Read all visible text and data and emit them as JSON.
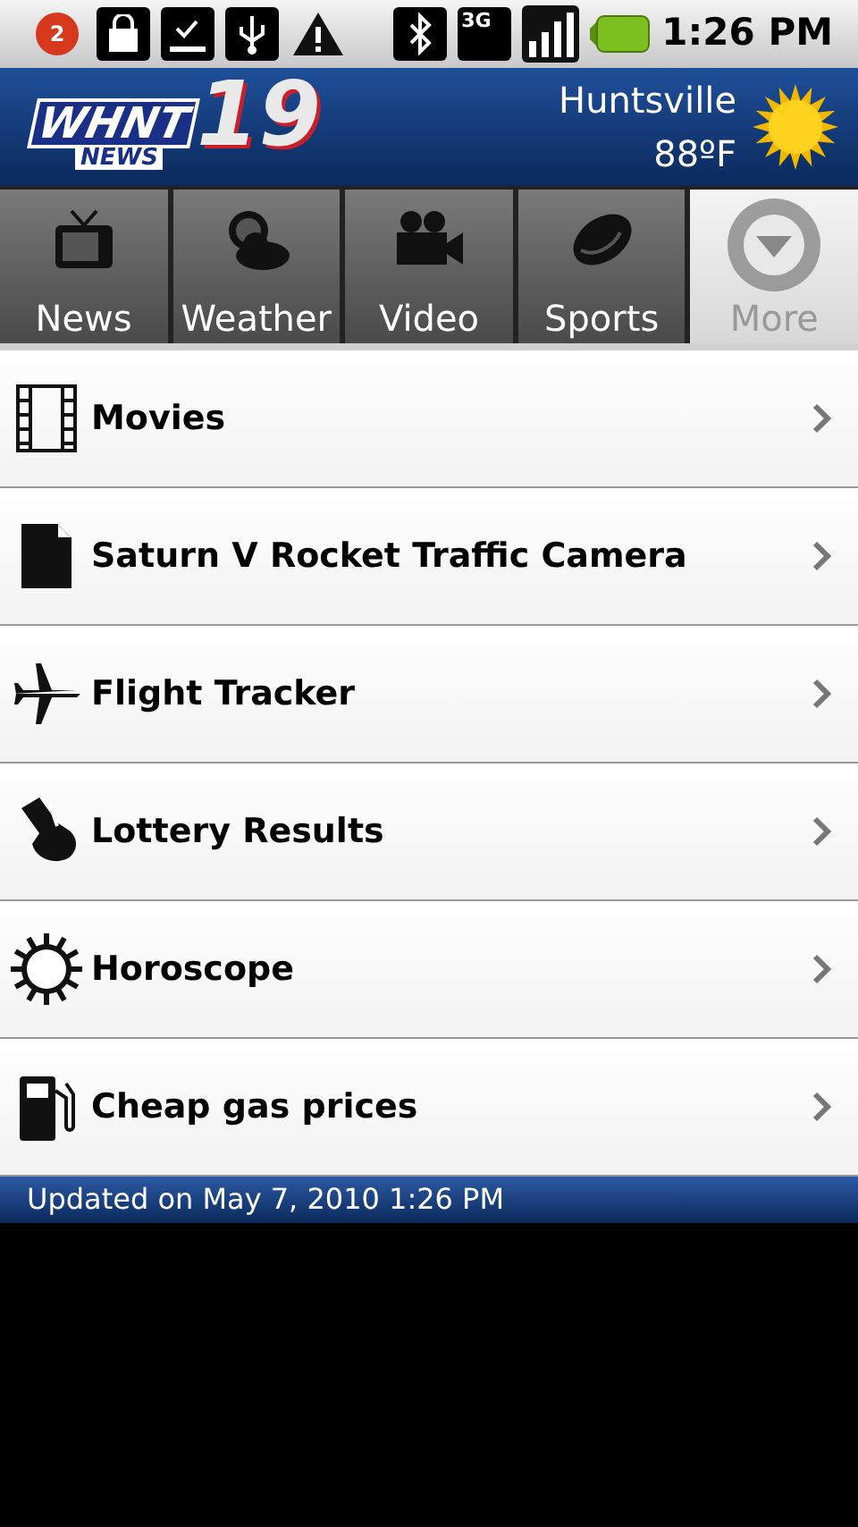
{
  "status_bar": {
    "notification_count": "2",
    "network": "3G",
    "time": "1:26 PM"
  },
  "header": {
    "logo": {
      "name": "WHNT",
      "sub": "NEWS",
      "channel": "19"
    },
    "city": "Huntsville",
    "temperature": "88ºF"
  },
  "tabs": [
    {
      "label": "News",
      "kind": "tv",
      "selected": false
    },
    {
      "label": "Weather",
      "kind": "weather",
      "selected": false
    },
    {
      "label": "Video",
      "kind": "camera",
      "selected": false
    },
    {
      "label": "Sports",
      "kind": "football",
      "selected": false
    },
    {
      "label": "More",
      "kind": "more",
      "selected": true
    }
  ],
  "items": [
    {
      "label": "Movies",
      "kind": "film"
    },
    {
      "label": "Saturn V Rocket Traffic Camera",
      "kind": "document"
    },
    {
      "label": "Flight Tracker",
      "kind": "plane"
    },
    {
      "label": "Lottery Results",
      "kind": "lottery"
    },
    {
      "label": "Horoscope",
      "kind": "sun"
    },
    {
      "label": "Cheap gas prices",
      "kind": "gas"
    }
  ],
  "footer": "Updated on May 7, 2010 1:26 PM"
}
